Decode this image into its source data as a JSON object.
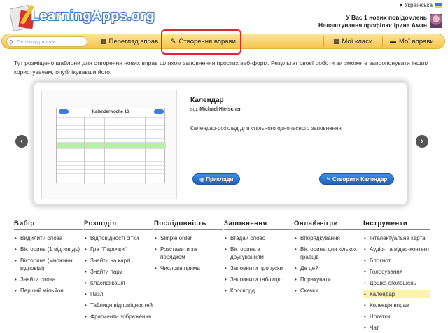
{
  "header": {
    "logo_text": "LearningApps.org",
    "language": "Українська",
    "messages": "У Вас 1 нових повідомлень",
    "profile": "Налаштування профілю: Ірина Аман"
  },
  "nav": {
    "search_placeholder": "Перегляд вправ",
    "browse": "Перегляд вправ",
    "create": "Створення вправи",
    "classes": "Мої класи",
    "exercises": "Мої вправи"
  },
  "intro": "Тут розміщено шаблони для створення нових вправ шляхом заповнення простих веб-форм. Результат своєї роботи ви зможете запропонувати іншим користувачам, опублікувавши його.",
  "card": {
    "preview_title": "Kalenderwoche 16",
    "title": "Календар",
    "author_prefix": "від:",
    "author": "Michael Hielscher",
    "description": "Календар-розклад для спільного одночасного заповнення",
    "examples_button": "Приклади",
    "create_button": "Створити Календар"
  },
  "categories": [
    {
      "title": "Вибір",
      "items": [
        "Видилити слова",
        "Вікторина (1 відповідь)",
        "Вікторина (множинні відповіді)",
        "Знайти слова",
        "Перший мільйон"
      ]
    },
    {
      "title": "Розподіл",
      "items": [
        "Відповідності сітки",
        "Гра \"Парочки\"",
        "Знайти на карті",
        "Знайти пару",
        "Класифікація",
        "Пазл",
        "Таблиця відповідностей",
        "Фрагменти зображення"
      ]
    },
    {
      "title": "Послідовність",
      "items": [
        "Simple order",
        "Розставити за порядком",
        "Числова пряма"
      ]
    },
    {
      "title": "Заповнення",
      "items": [
        "Вгадай слово",
        "Вікторина з друкуванням",
        "Заповнити пропуски",
        "Заповнити таблицю",
        "Кросворд"
      ]
    },
    {
      "title": "Онлайн-ігри",
      "items": [
        "Впорядкування",
        "Вікторина для кількох гравців",
        "Де це?",
        "Порахувати",
        "Скачки"
      ]
    },
    {
      "title": "Інструменти",
      "items": [
        "Інтелектуальна карта",
        "Аудіо- та відео-контент",
        "Блокнот",
        "Голосування",
        "Дошка оголошень",
        "Календар",
        "Колекція вправ",
        "Нотатки",
        "Чат"
      ]
    }
  ],
  "active_category_item": "Календар"
}
